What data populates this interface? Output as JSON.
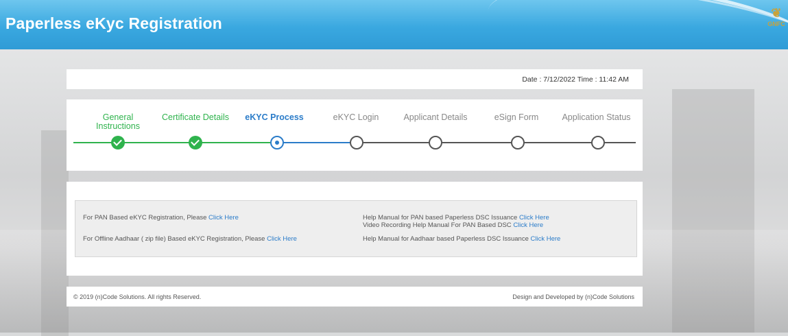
{
  "header": {
    "title": "Paperless eKyc Registration",
    "logo_text": "GNFC"
  },
  "date_bar": {
    "text": "Date : 7/12/2022 Time : 11:42 AM"
  },
  "steps": [
    {
      "label": "General Instructions",
      "status": "done"
    },
    {
      "label": "Certificate Details",
      "status": "done"
    },
    {
      "label": "eKYC Process",
      "status": "active"
    },
    {
      "label": "eKYC Login",
      "status": "pending"
    },
    {
      "label": "Applicant Details",
      "status": "pending"
    },
    {
      "label": "eSign Form",
      "status": "pending"
    },
    {
      "label": "Application Status",
      "status": "pending"
    }
  ],
  "links": {
    "pan": {
      "text": "For PAN Based eKYC Registration, Please ",
      "link": "Click Here"
    },
    "offline": {
      "text": "For Offline Aadhaar ( zip file) Based eKYC Registration, Please ",
      "link": "Click Here"
    },
    "pan_manual": {
      "text": "Help Manual for PAN based Paperless DSC Issuance ",
      "link": "Click Here"
    },
    "video_manual": {
      "text": "Video Recording Help Manual For PAN Based DSC ",
      "link": "Click Here"
    },
    "aadhaar_manual": {
      "text": "Help Manual for Aadhaar based Paperless DSC Issuance ",
      "link": "Click Here"
    }
  },
  "footer": {
    "copyright": "© 2019 (n)Code Solutions. All rights Reserved.",
    "credit": "Design and Developed by (n)Code Solutions"
  },
  "colors": {
    "header": "#3aa8e0",
    "done": "#2fb34d",
    "active": "#2b7cc9",
    "pending": "#555555"
  }
}
